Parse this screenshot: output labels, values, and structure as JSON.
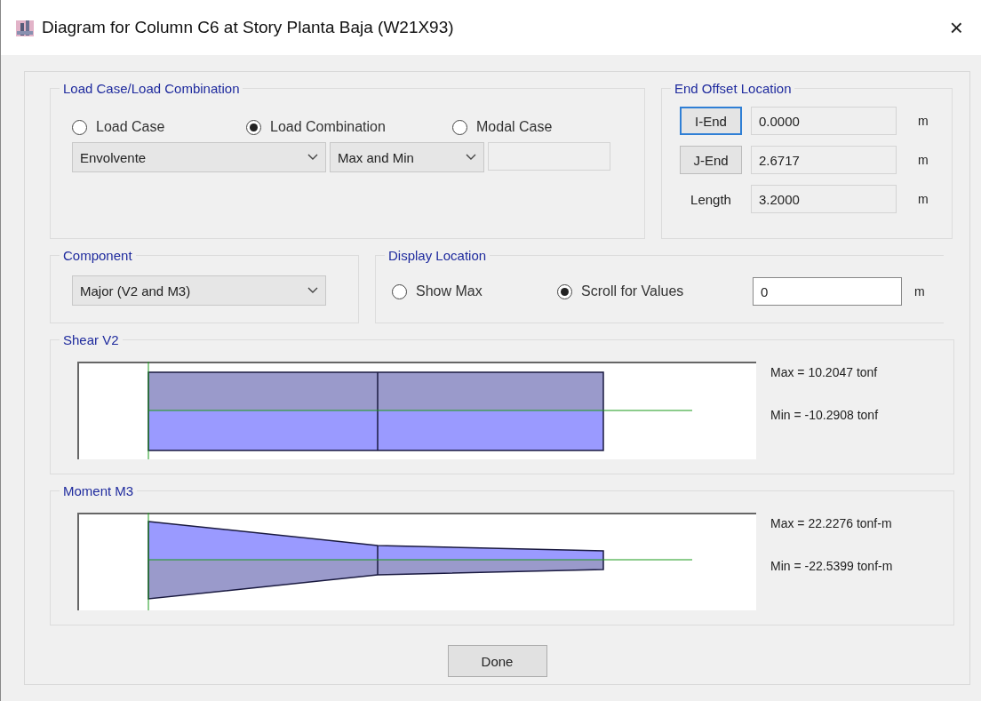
{
  "window": {
    "title": "Diagram for Column C6 at Story Planta Baja (W21X93)",
    "close": "×"
  },
  "load_case_group": {
    "title": "Load Case/Load Combination",
    "options": [
      {
        "label": "Load Case",
        "selected": false
      },
      {
        "label": "Load Combination",
        "selected": true
      },
      {
        "label": "Modal Case",
        "selected": false
      }
    ],
    "case_dropdown": {
      "value": "Envolvente"
    },
    "type_dropdown": {
      "value": "Max and Min"
    }
  },
  "end_offset": {
    "title": "End Offset Location",
    "rows": [
      {
        "kind": "button",
        "label": "I-End",
        "focused": true,
        "value": "0.0000",
        "unit": "m"
      },
      {
        "kind": "button",
        "label": "J-End",
        "focused": false,
        "value": "2.6717",
        "unit": "m"
      },
      {
        "kind": "label",
        "label": "Length",
        "value": "3.2000",
        "unit": "m"
      }
    ]
  },
  "component": {
    "title": "Component",
    "value": "Major (V2 and M3)"
  },
  "display_location": {
    "title": "Display Location",
    "options": [
      {
        "label": "Show Max",
        "selected": false
      },
      {
        "label": "Scroll for Values",
        "selected": true
      }
    ],
    "value": "0",
    "unit": "m"
  },
  "diagrams": [
    {
      "kind": "shear",
      "title": "Shear V2",
      "max": "Max = 10.2047 tonf",
      "min": "Min = -10.2908 tonf"
    },
    {
      "kind": "moment",
      "title": "Moment M3",
      "max": "Max = 22.2276 tonf-m",
      "min": "Min = -22.5399 tonf-m"
    }
  ],
  "buttons": [
    {
      "label": "Done"
    }
  ]
}
